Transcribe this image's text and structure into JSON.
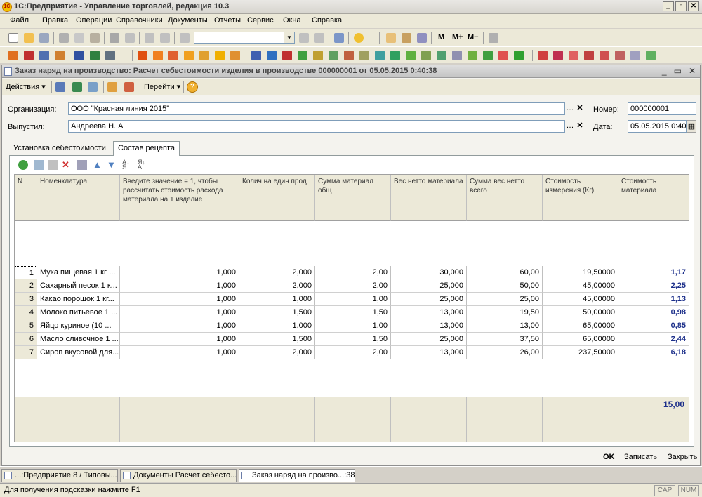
{
  "app": {
    "title": "1С:Предприятие - Управление торговлей, редакция 10.3",
    "icon_label": "1С",
    "window_buttons": [
      "_",
      "▫",
      "✕"
    ]
  },
  "menu": [
    "Файл",
    "Правка",
    "Операции",
    "Справочники",
    "Документы",
    "Отчеты",
    "Сервис",
    "Окна",
    "Справка"
  ],
  "toolbar": {
    "memory_buttons": [
      "M",
      "M+",
      "M−"
    ]
  },
  "document": {
    "title": "Заказ наряд на производство: Расчет себестоимости изделия в производстве 000000001 от 05.05.2015 0:40:38",
    "actions_label": "Действия",
    "goto_label": "Перейти",
    "help_label": "?",
    "fields": {
      "organization_label": "Организация:",
      "organization_value": "ООО \"Красная линия 2015\"",
      "issued_label": "Выпустил:",
      "issued_value": "Андреева Н. А",
      "number_label": "Номер:",
      "number_value": "000000001",
      "date_label": "Дата:",
      "date_value": "05.05.2015  0:40"
    },
    "tabs": [
      {
        "label": "Установка себестоимости",
        "active": false
      },
      {
        "label": "Состав рецепта",
        "active": true
      }
    ],
    "table": {
      "headers": [
        "N",
        "Номенклатура",
        "Введите значение = 1, чтобы рассчитать стоимость расхода материала на 1 изделие",
        "Колич на един прод",
        "Сумма материал общ",
        "Вес нетто материала",
        "Сумма вес нетто всего",
        "Стоимость измерения (Кг)",
        "Стоимость материала"
      ],
      "rows": [
        [
          "1",
          "Мука пищевая 1 кг ...",
          "1,000",
          "2,000",
          "2,00",
          "30,000",
          "60,00",
          "19,50000",
          "1,17"
        ],
        [
          "2",
          "Сахарный песок 1 к...",
          "1,000",
          "2,000",
          "2,00",
          "25,000",
          "50,00",
          "45,00000",
          "2,25"
        ],
        [
          "3",
          "Какао порошок 1 кг...",
          "1,000",
          "1,000",
          "1,00",
          "25,000",
          "25,00",
          "45,00000",
          "1,13"
        ],
        [
          "4",
          "Молоко питьевое 1 ...",
          "1,000",
          "1,500",
          "1,50",
          "13,000",
          "19,50",
          "50,00000",
          "0,98"
        ],
        [
          "5",
          "Яйцо куриное (10 ...",
          "1,000",
          "1,000",
          "1,00",
          "13,000",
          "13,00",
          "65,00000",
          "0,85"
        ],
        [
          "6",
          "Масло сливочное 1 ...",
          "1,000",
          "1,500",
          "1,50",
          "25,000",
          "37,50",
          "65,00000",
          "2,44"
        ],
        [
          "7",
          "Сироп вкусовой для...",
          "1,000",
          "2,000",
          "2,00",
          "13,000",
          "26,00",
          "237,50000",
          "6,18"
        ]
      ],
      "total": "15,00"
    },
    "buttons": {
      "ok": "OK",
      "save": "Записать",
      "close": "Закрыть"
    }
  },
  "taskbar": [
    {
      "label": "...:Предприятие 8 / Типовы...",
      "active": false
    },
    {
      "label": "Документы Расчет себесто...",
      "active": false
    },
    {
      "label": "Заказ наряд на произво...:38",
      "active": true
    }
  ],
  "status": {
    "hint": "Для получения подсказки нажмите F1",
    "cap": "CAP",
    "num": "NUM"
  }
}
